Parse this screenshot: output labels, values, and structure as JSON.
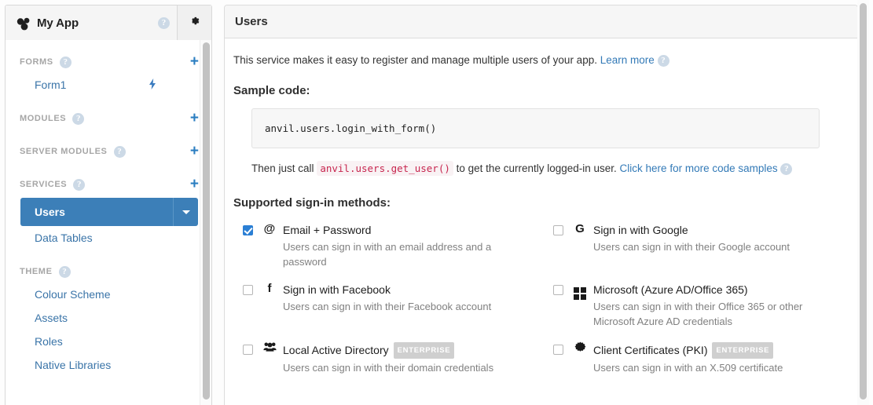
{
  "sidebar": {
    "app_title": "My App",
    "app_logo_icon": "anvil-blocks-logo-icon",
    "app_help_icon": "help-circle-icon",
    "gear_icon": "gear-icon",
    "sections": [
      {
        "label": "FORMS",
        "help_icon": "help-circle-icon",
        "add_label": "+",
        "items": [
          {
            "label": "Form1",
            "trailing_icon": "lightning-bolt-icon"
          }
        ]
      },
      {
        "label": "MODULES",
        "help_icon": "help-circle-icon",
        "add_label": "+",
        "items": []
      },
      {
        "label": "SERVER MODULES",
        "help_icon": "help-circle-icon",
        "add_label": "+",
        "items": []
      },
      {
        "label": "SERVICES",
        "help_icon": "help-circle-icon",
        "add_label": "+",
        "selected": {
          "label": "Users",
          "caret_icon": "caret-down-icon"
        },
        "items": [
          {
            "label": "Data Tables",
            "trailing_icon": ""
          }
        ]
      },
      {
        "label": "THEME",
        "help_icon": "help-circle-icon",
        "add_label": "",
        "items": [
          {
            "label": "Colour Scheme",
            "trailing_icon": ""
          },
          {
            "label": "Assets",
            "trailing_icon": ""
          },
          {
            "label": "Roles",
            "trailing_icon": ""
          },
          {
            "label": "Native Libraries",
            "trailing_icon": ""
          }
        ]
      }
    ]
  },
  "main": {
    "title": "Users",
    "intro_text": "This service makes it easy to register and manage multiple users of your app.",
    "intro_link": "Learn more",
    "intro_help_icon": "help-circle-icon",
    "sample_code_heading": "Sample code:",
    "sample_code": "anvil.users.login_with_form()",
    "then_prefix": "Then just call",
    "then_code": "anvil.users.get_user()",
    "then_suffix": "to get the currently logged-in user.",
    "then_link": "Click here for more code samples",
    "then_help_icon": "help-circle-icon",
    "methods_heading": "Supported sign-in methods:",
    "methods": [
      {
        "checked": true,
        "icon": "at-sign-icon",
        "glyph": "@",
        "title": "Email + Password",
        "badge": "",
        "description": "Users can sign in with an email address and a password"
      },
      {
        "checked": false,
        "icon": "google-g-icon",
        "glyph": "G",
        "title": "Sign in with Google",
        "badge": "",
        "description": "Users can sign in with their Google account"
      },
      {
        "checked": false,
        "icon": "facebook-f-icon",
        "glyph": "f",
        "title": "Sign in with Facebook",
        "badge": "",
        "description": "Users can sign in with their Facebook account"
      },
      {
        "checked": false,
        "icon": "microsoft-windows-icon",
        "glyph": "",
        "title": "Microsoft (Azure AD/Office 365)",
        "badge": "",
        "description": "Users can sign in with their Office 365 or other Microsoft Azure AD credentials"
      },
      {
        "checked": false,
        "icon": "users-group-icon",
        "glyph": "☰",
        "title": "Local Active Directory",
        "badge": "ENTERPRISE",
        "description": "Users can sign in with their domain credentials"
      },
      {
        "checked": false,
        "icon": "certificate-seal-icon",
        "glyph": "✸",
        "title": "Client Certificates (PKI)",
        "badge": "ENTERPRISE",
        "description": "Users can sign in with an X.509 certificate"
      }
    ]
  },
  "colors": {
    "accent_blue": "#337ab7",
    "service_selected": "#3c7fb8",
    "checkbox_checked": "#2b7fd4",
    "link": "#337ab7",
    "code_pink": "#c7254e",
    "badge_grey": "#cfcfcf"
  }
}
